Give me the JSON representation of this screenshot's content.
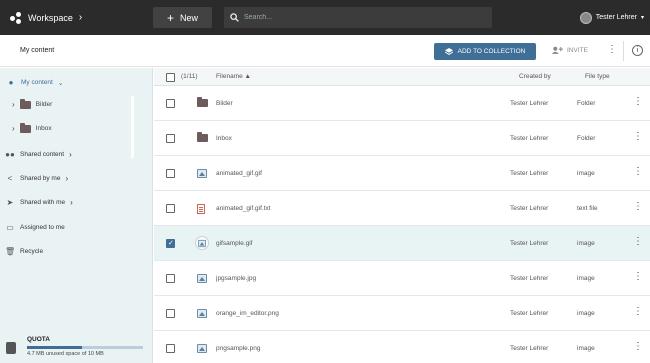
{
  "topbar": {
    "title": "Workspace",
    "new_label": "New",
    "search_placeholder": "Search...",
    "user_name": "Tester Lehrer"
  },
  "subbar": {
    "breadcrumb": "My content",
    "add_to_collection": "ADD TO COLLECTION",
    "invite": "INVITE",
    "info": "i"
  },
  "sidebar": {
    "my_content": "My content",
    "children": [
      "Bilder",
      "Inbox"
    ],
    "shared_content": "Shared content",
    "shared_by_me": "Shared by me",
    "shared_with_me": "Shared with me",
    "assigned_to_me": "Assigned to me",
    "recycle": "Recycle",
    "quota": {
      "label": "QUOTA",
      "used_fraction": 0.47,
      "text": "4.7 MB unused space of 10 MB"
    }
  },
  "table": {
    "selection_count": "(1/11)",
    "col_filename": "Filename",
    "col_created_by": "Created by",
    "col_file_type": "File type",
    "rows": [
      {
        "name": "Bilder",
        "by": "Tester Lehrer",
        "type": "Folder",
        "icon": "folder-icon",
        "selected": false
      },
      {
        "name": "Inbox",
        "by": "Tester Lehrer",
        "type": "Folder",
        "icon": "folder-icon",
        "selected": false
      },
      {
        "name": "animated_gif.gif",
        "by": "Tester Lehrer",
        "type": "image",
        "icon": "image-icon",
        "selected": false
      },
      {
        "name": "animated_gif.gif.txt",
        "by": "Tester Lehrer",
        "type": "text file",
        "icon": "text-file-icon",
        "selected": false
      },
      {
        "name": "gifsample.gif",
        "by": "Tester Lehrer",
        "type": "image",
        "icon": "image-icon",
        "selected": true
      },
      {
        "name": "jpgsample.jpg",
        "by": "Tester Lehrer",
        "type": "image",
        "icon": "image-icon",
        "selected": false
      },
      {
        "name": "orange_im_editor.png",
        "by": "Tester Lehrer",
        "type": "image",
        "icon": "image-icon",
        "selected": false
      },
      {
        "name": "pngsample.png",
        "by": "Tester Lehrer",
        "type": "image",
        "icon": "image-icon",
        "selected": false
      }
    ]
  },
  "colors": {
    "topbar": "#2b2b2b",
    "accent": "#3f6f97",
    "sidebar_bg": "#eaf3f4",
    "selected_row": "#e8f4f3"
  }
}
